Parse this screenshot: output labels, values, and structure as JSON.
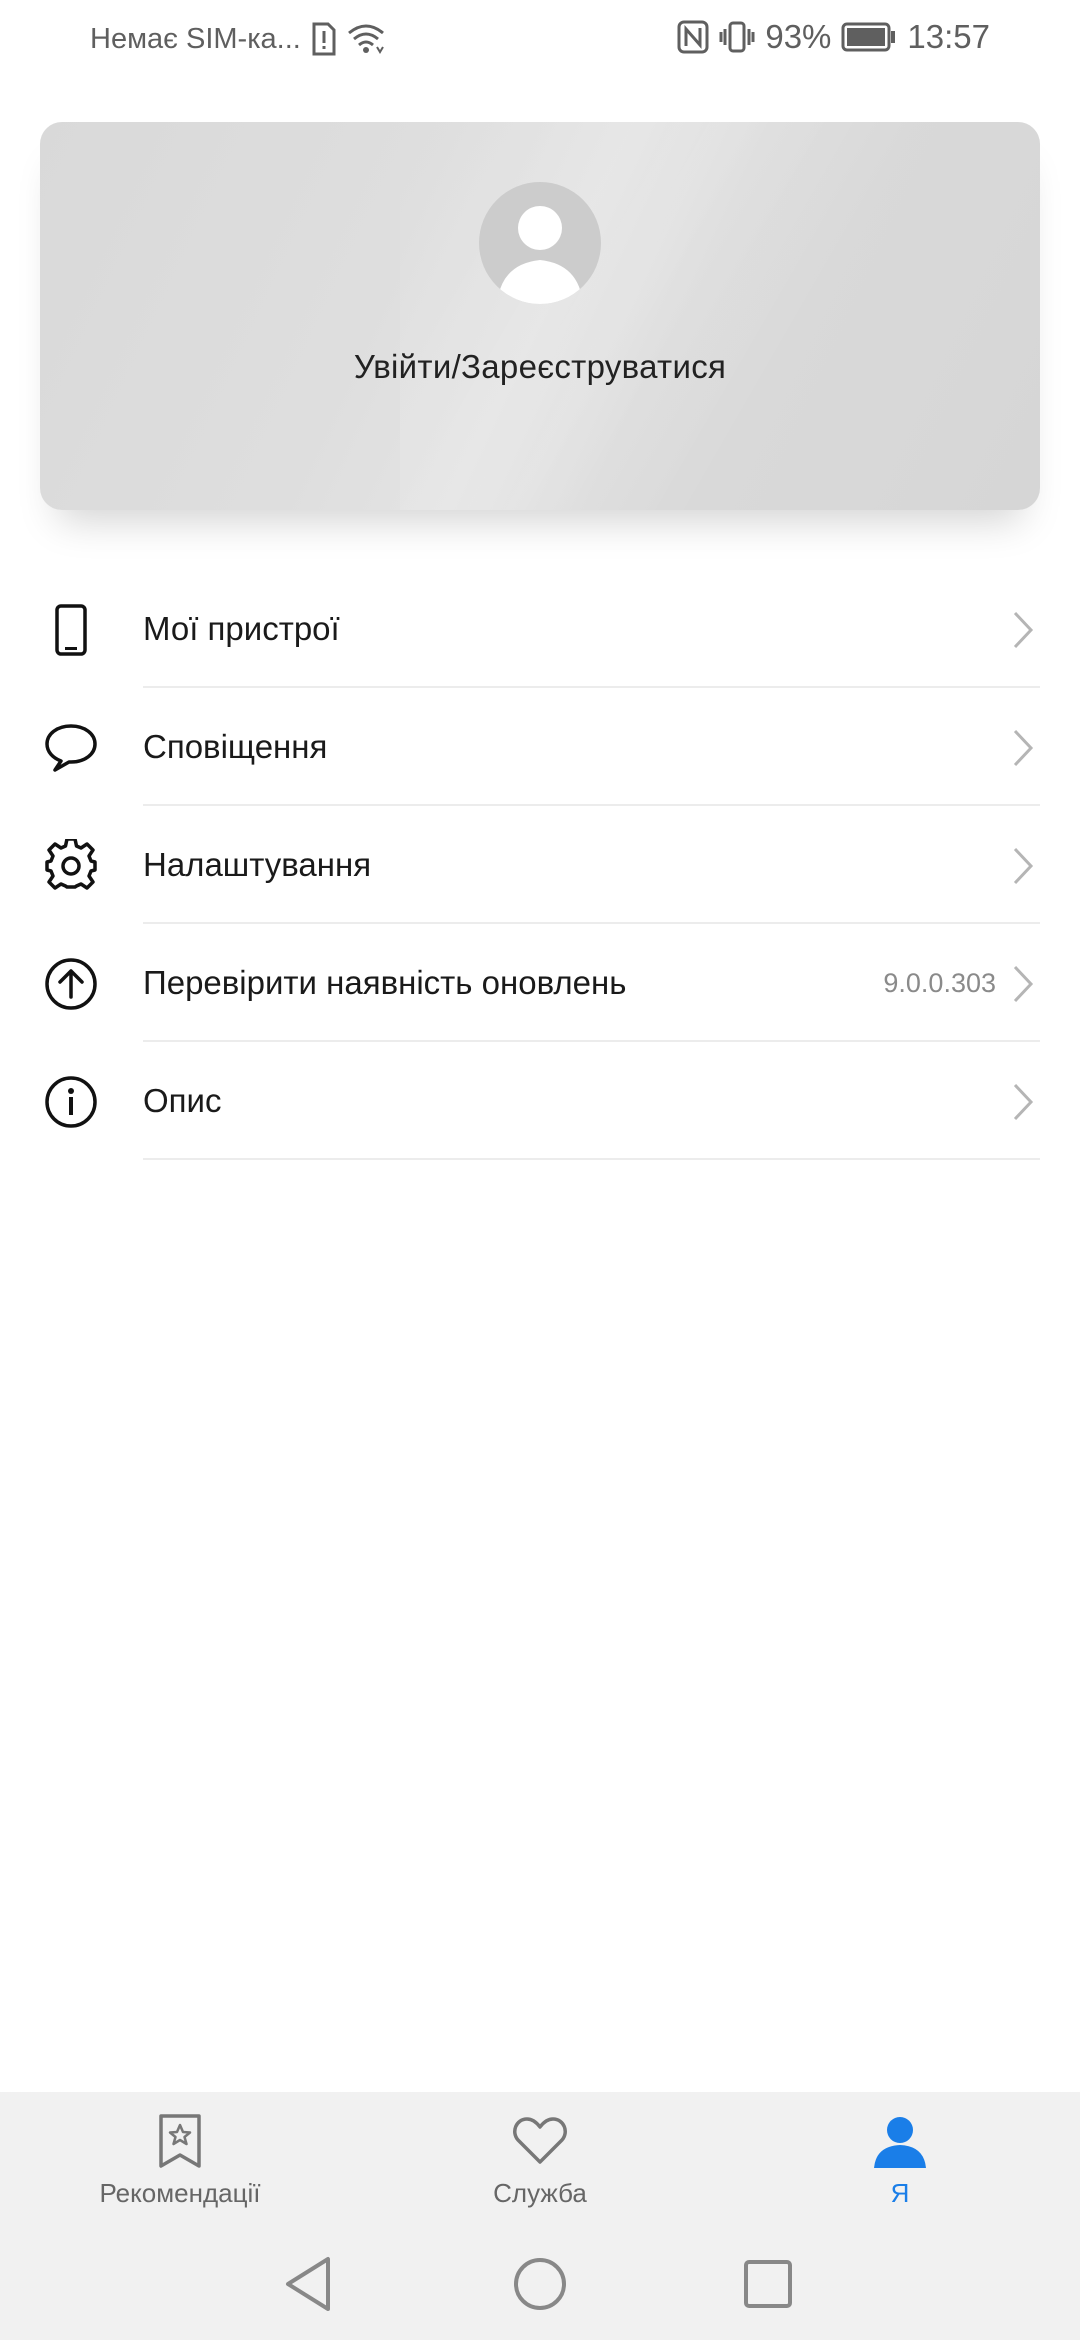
{
  "status_bar": {
    "carrier": "Немає SIM-ка...",
    "battery": "93%",
    "time": "13:57"
  },
  "account": {
    "login_label": "Увійти/Зареєструватися"
  },
  "menu": {
    "items": [
      {
        "label": "Мої пристрої",
        "icon": "phone-icon"
      },
      {
        "label": "Сповіщення",
        "icon": "chat-bubble-icon"
      },
      {
        "label": "Налаштування",
        "icon": "gear-icon"
      },
      {
        "label": "Перевірити наявність оновлень",
        "value": "9.0.0.303",
        "icon": "arrow-up-circle-icon"
      },
      {
        "label": "Опис",
        "icon": "info-icon"
      }
    ]
  },
  "bottom_nav": {
    "tabs": [
      {
        "label": "Рекомендації",
        "icon": "bookmark-star-icon"
      },
      {
        "label": "Служба",
        "icon": "heart-icon"
      },
      {
        "label": "Я",
        "icon": "person-icon",
        "active": true
      }
    ]
  },
  "colors": {
    "accent": "#1a7ee8",
    "card": "#dcdcdc",
    "nav_bg": "#f1f1f1"
  }
}
